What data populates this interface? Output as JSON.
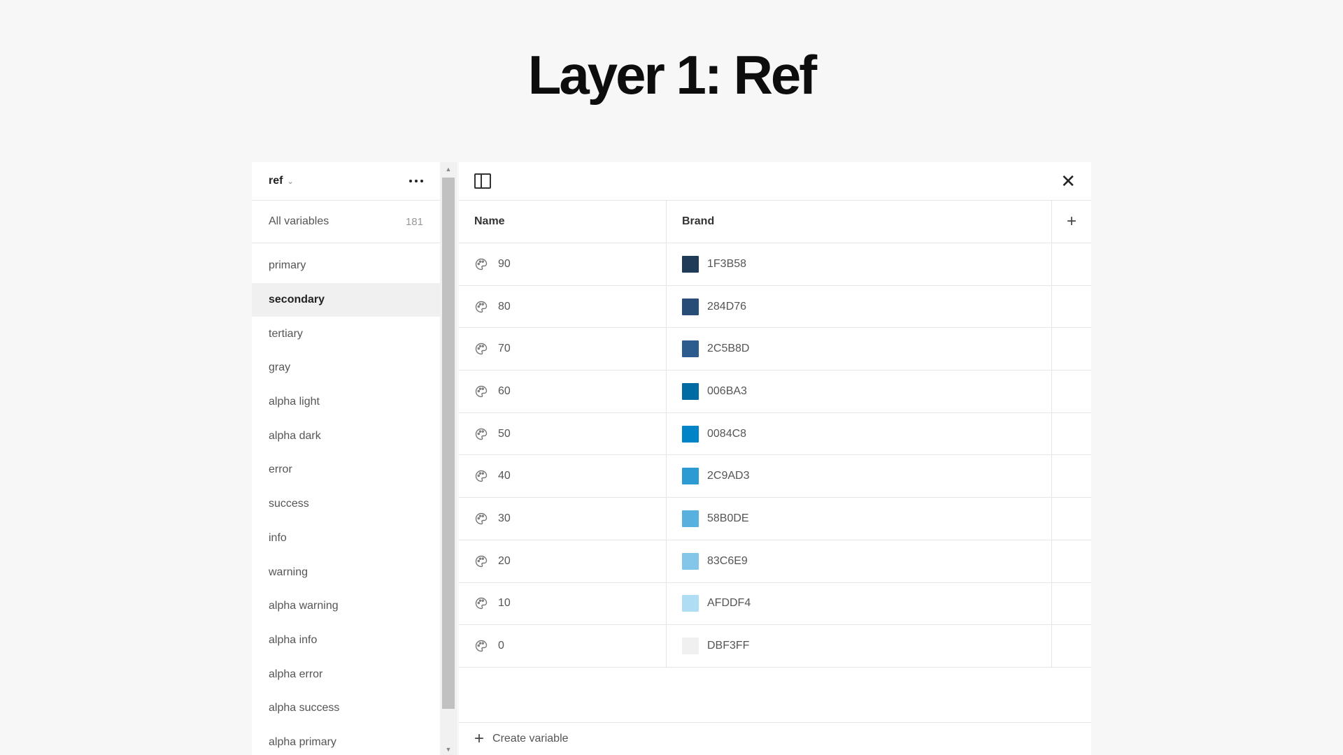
{
  "page": {
    "title": "Layer 1: Ref"
  },
  "sidebar": {
    "collection": "ref",
    "all_variables_label": "All variables",
    "all_variables_count": "181",
    "groups": [
      "primary",
      "secondary",
      "tertiary",
      "gray",
      "alpha light",
      "alpha dark",
      "error",
      "success",
      "info",
      "warning",
      "alpha warning",
      "alpha info",
      "alpha error",
      "alpha success",
      "alpha primary"
    ],
    "selected_group": "secondary"
  },
  "table": {
    "columns": {
      "name": "Name",
      "mode": "Brand"
    },
    "rows": [
      {
        "name": "90",
        "value": "1F3B58",
        "color": "#1F3B58"
      },
      {
        "name": "80",
        "value": "284D76",
        "color": "#284D76"
      },
      {
        "name": "70",
        "value": "2C5B8D",
        "color": "#2C5B8D"
      },
      {
        "name": "60",
        "value": "006BA3",
        "color": "#006BA3"
      },
      {
        "name": "50",
        "value": "0084C8",
        "color": "#0084C8"
      },
      {
        "name": "40",
        "value": "2C9AD3",
        "color": "#2C9AD3"
      },
      {
        "name": "30",
        "value": "58B0DE",
        "color": "#58B0DE"
      },
      {
        "name": "20",
        "value": "83C6E9",
        "color": "#83C6E9"
      },
      {
        "name": "10",
        "value": "AFDDF4",
        "color": "#AFDDF4"
      },
      {
        "name": "0",
        "value": "DBF3FF",
        "color": "#DBF3FF"
      }
    ]
  },
  "footer": {
    "create_label": "Create variable"
  }
}
